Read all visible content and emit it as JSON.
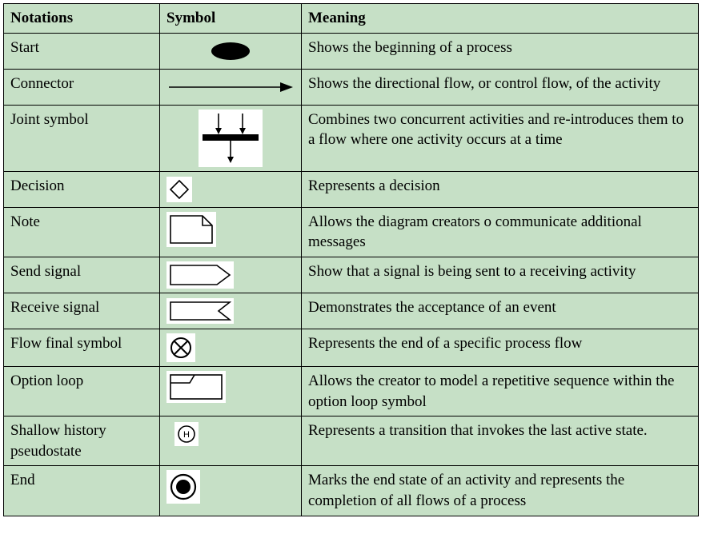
{
  "headers": {
    "notations": "Notations",
    "symbol": "Symbol",
    "meaning": "Meaning"
  },
  "rows": [
    {
      "notation": "Start",
      "symbol_name": "start-icon",
      "meaning": "Shows the beginning of a process"
    },
    {
      "notation": "Connector",
      "symbol_name": "connector-icon",
      "meaning": "Shows the directional flow, or control flow, of the activity"
    },
    {
      "notation": "Joint symbol",
      "symbol_name": "joint-icon",
      "meaning": "Combines two concurrent activities and re-introduces them to a flow where one activity occurs at a time"
    },
    {
      "notation": "Decision",
      "symbol_name": "decision-icon",
      "meaning": "Represents a decision"
    },
    {
      "notation": "Note",
      "symbol_name": "note-icon",
      "meaning": "Allows the diagram creators o communicate additional messages"
    },
    {
      "notation": "Send signal",
      "symbol_name": "send-signal-icon",
      "meaning": "Show that a signal is being sent to a receiving activity"
    },
    {
      "notation": "Receive signal",
      "symbol_name": "receive-signal-icon",
      "meaning": "Demonstrates the acceptance of an event"
    },
    {
      "notation": "Flow final symbol",
      "symbol_name": "flow-final-icon",
      "meaning": "Represents the end of a specific process flow"
    },
    {
      "notation": "Option loop",
      "symbol_name": "option-loop-icon",
      "meaning": "Allows the creator to model a repetitive sequence within the option loop symbol"
    },
    {
      "notation": "Shallow history pseudostate",
      "symbol_name": "shallow-history-icon",
      "meaning": "Represents a transition that invokes the last active state."
    },
    {
      "notation": "End",
      "symbol_name": "end-icon",
      "meaning": "Marks the end state of an activity and represents the completion of all flows of a process"
    }
  ]
}
